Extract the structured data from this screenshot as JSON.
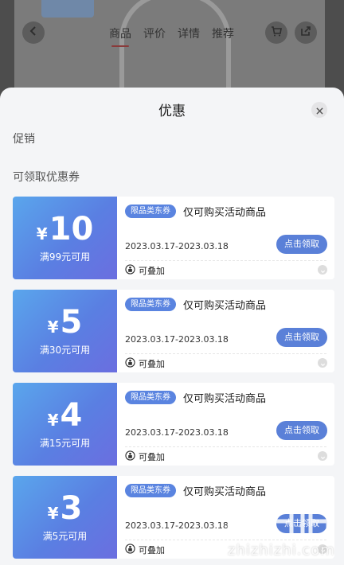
{
  "background_page": {
    "tabs": [
      "商品",
      "评价",
      "详情",
      "推荐"
    ]
  },
  "sheet": {
    "title": "优惠",
    "close_icon": "close-icon",
    "section_promotion": "促销",
    "section_coupons": "可领取优惠券"
  },
  "coupons": [
    {
      "currency": "¥",
      "amount": "10",
      "condition": "满99元可用",
      "tag": "限品类东券",
      "title": "仅可购买活动商品",
      "validity": "2023.03.17-2023.03.18",
      "claim_label": "点击领取",
      "stack_label": "可叠加"
    },
    {
      "currency": "¥",
      "amount": "5",
      "condition": "满30元可用",
      "tag": "限品类东券",
      "title": "仅可购买活动商品",
      "validity": "2023.03.17-2023.03.18",
      "claim_label": "点击领取",
      "stack_label": "可叠加"
    },
    {
      "currency": "¥",
      "amount": "4",
      "condition": "满15元可用",
      "tag": "限品类东券",
      "title": "仅可购买活动商品",
      "validity": "2023.03.17-2023.03.18",
      "claim_label": "点击领取",
      "stack_label": "可叠加"
    },
    {
      "currency": "¥",
      "amount": "3",
      "condition": "满5元可用",
      "tag": "限品类东券",
      "title": "仅可购买活动商品",
      "validity": "2023.03.17-2023.03.18",
      "claim_label": "点击领取",
      "stack_label": "可叠加"
    }
  ],
  "watermark": {
    "text": "zhizhizhi.com"
  },
  "colors": {
    "coupon_gradient_start": "#5aa6ec",
    "coupon_gradient_end": "#6b6ee0",
    "claim_button": "#5a80d8",
    "tag": "#5a84e0"
  }
}
